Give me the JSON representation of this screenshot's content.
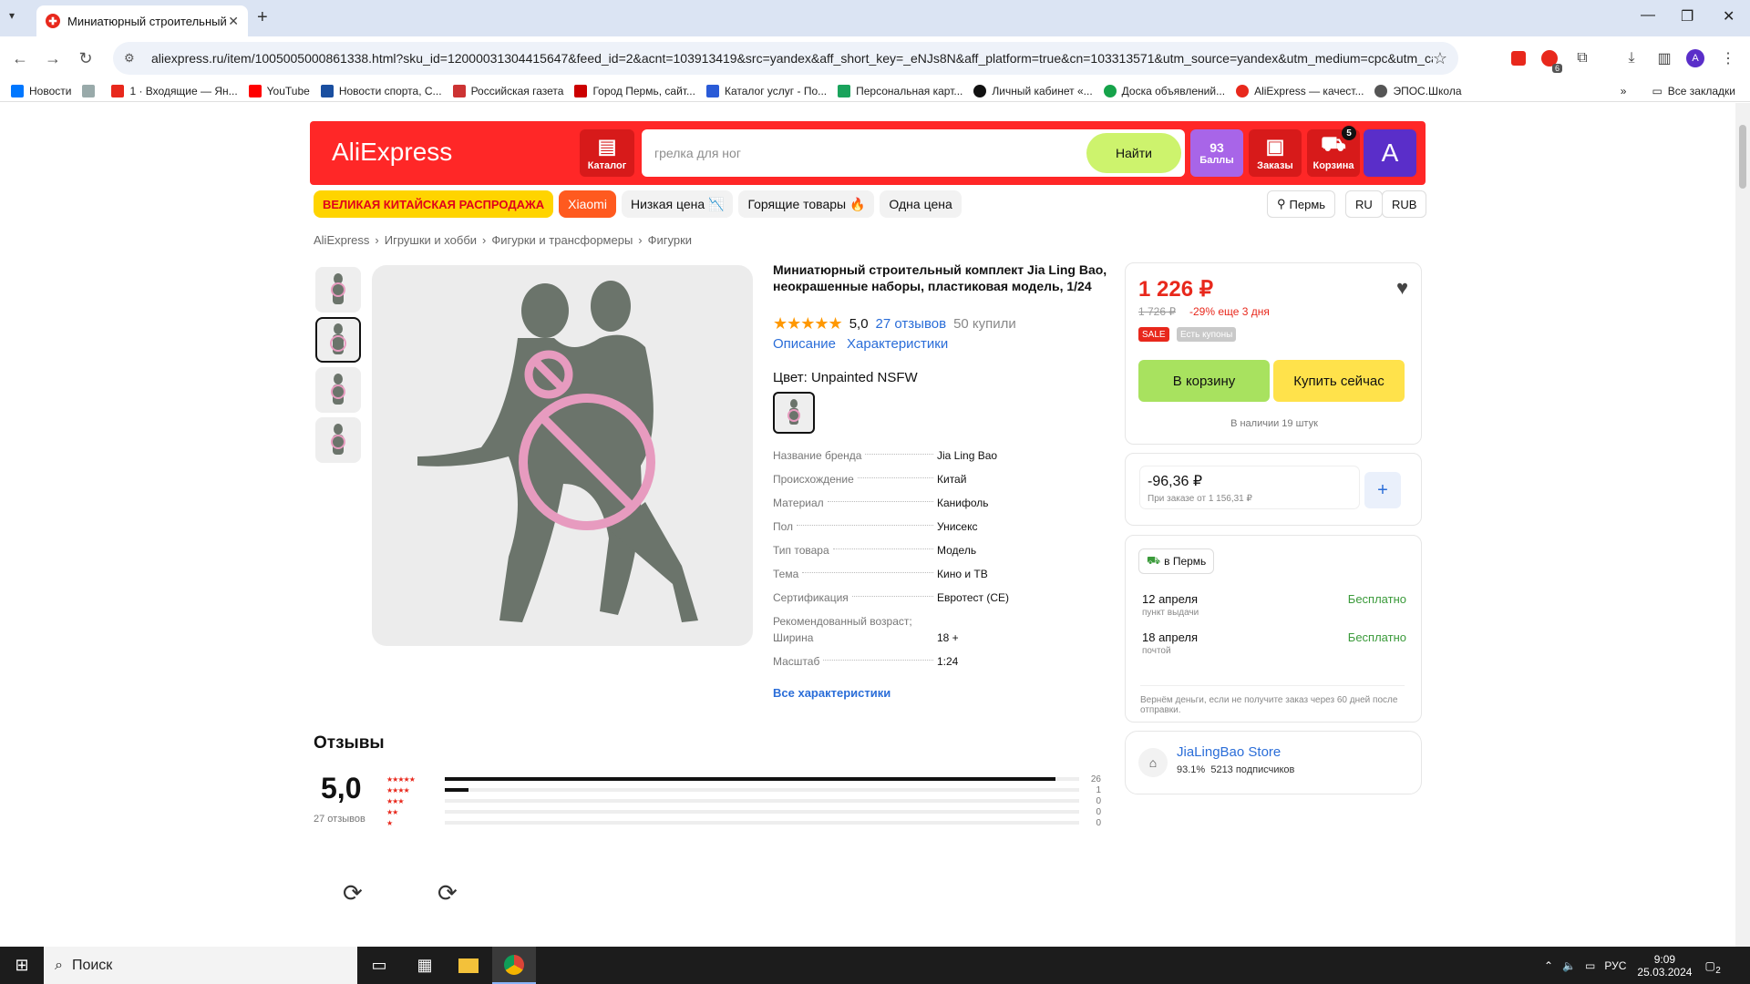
{
  "browser": {
    "tab_title": "Миниатюрный строительный",
    "url": "aliexpress.ru/item/1005005000861338.html?sku_id=12000031304415647&feed_id=2&acnt=103913419&src=yandex&aff_short_key=_eNJs8N&aff_platform=true&cn=103313571&utm_source=yandex&utm_medium=cpc&utm_camp...",
    "ext_badge": "6",
    "profile": "A",
    "all_bookmarks": "Все закладки",
    "bookmarks": [
      "Новости",
      "1 · Входящие — Ян...",
      "YouTube",
      "Новости спорта, С...",
      "Российская газета",
      "Город Пермь, сайт...",
      "Каталог услуг - По...",
      "Персональная карт...",
      "Личный кабинет «...",
      "Доска объявлений...",
      "AliExpress — качест...",
      "ЭПОС.Школа"
    ],
    "bookmark_colors": [
      "#0077ff",
      "#9aa",
      "#e8281c",
      "#ff0000",
      "#1a4fa0",
      "#cc3333",
      "#cc0000",
      "#2a5bd7",
      "#1aa35c",
      "#111",
      "#16a34a",
      "#e8281c",
      "#555"
    ]
  },
  "header": {
    "logo": "AliExpress",
    "catalog": "Каталог",
    "search_placeholder": "грелка для ног",
    "search_button": "Найти",
    "points_value": "93",
    "points_label": "Баллы",
    "orders": "Заказы",
    "cart": "Корзина",
    "cart_count": "5",
    "avatar": "A"
  },
  "promos": [
    "ВЕЛИКАЯ КИТАЙСКАЯ РАСПРОДАЖА",
    "Xiaomi",
    "Низкая цена 📉",
    "Горящие товары 🔥",
    "Одна цена"
  ],
  "region": {
    "city": "Пермь",
    "lang": "RU",
    "currency": "RUB"
  },
  "breadcrumbs": [
    "AliExpress",
    "Игрушки и хобби",
    "Фигурки и трансформеры",
    "Фигурки"
  ],
  "product": {
    "title": "Миниатюрный строительный комплект Jia Ling Bao, неокрашенные наборы, пластиковая модель, 1/24",
    "rating": "5,0",
    "reviews_link": "27 отзывов",
    "sold": "50 купили",
    "tab_description": "Описание",
    "tab_specs": "Характеристики",
    "color_label": "Цвет: Unpainted NSFW",
    "specs": [
      {
        "k": "Название бренда",
        "v": "Jia Ling Bao"
      },
      {
        "k": "Происхождение",
        "v": "Китай"
      },
      {
        "k": "Материал",
        "v": "Канифоль"
      },
      {
        "k": "Пол",
        "v": "Унисекс"
      },
      {
        "k": "Тип товара",
        "v": "Модель"
      },
      {
        "k": "Тема",
        "v": "Кино и ТВ"
      },
      {
        "k": "Сертификация",
        "v": "Евротест (CE)"
      },
      {
        "k": "Рекомендованный возраст;",
        "v": ""
      },
      {
        "k": "Ширина",
        "v": "18 +"
      },
      {
        "k": "Масштаб",
        "v": "1:24"
      }
    ],
    "all_specs": "Все характеристики"
  },
  "buybox": {
    "price": "1 226 ₽",
    "old_price": "1 726 ₽",
    "discount": "-29% еще 3 дня",
    "badge_sale": "SALE",
    "badge_coupons": "Есть купоны",
    "add_to_cart": "В корзину",
    "buy_now": "Купить сейчас",
    "stock": "В наличии 19 штук",
    "coupon_value": "-96,36 ₽",
    "coupon_sub": "При заказе от 1 156,31 ₽",
    "delivery_city": "в Пермь",
    "delivery": [
      {
        "date": "12 апреля",
        "method": "пункт выдачи",
        "price": "Бесплатно"
      },
      {
        "date": "18 апреля",
        "method": "почтой",
        "price": "Бесплатно"
      }
    ],
    "refund": "Вернём деньги, если не получите заказ через 60 дней после отправки.",
    "store_name": "JiaLingBao Store",
    "store_rating": "93.1%",
    "store_followers": "5213 подписчиков"
  },
  "reviews": {
    "heading": "Отзывы",
    "score": "5,0",
    "count": "27 отзывов",
    "bars": [
      {
        "stars": "★★★★★",
        "count": "26",
        "fill": 0.963
      },
      {
        "stars": "★★★★",
        "count": "1",
        "fill": 0.037
      },
      {
        "stars": "★★★",
        "count": "0",
        "fill": 0
      },
      {
        "stars": "★★",
        "count": "0",
        "fill": 0
      },
      {
        "stars": "★",
        "count": "0",
        "fill": 0
      }
    ]
  },
  "taskbar": {
    "search": "Поиск",
    "lang": "РУС",
    "time": "9:09",
    "date": "25.03.2024",
    "notif_count": "2"
  },
  "colors": {
    "brand": "#ff2727",
    "accent_green": "#cdf36d",
    "price": "#e8281c"
  }
}
